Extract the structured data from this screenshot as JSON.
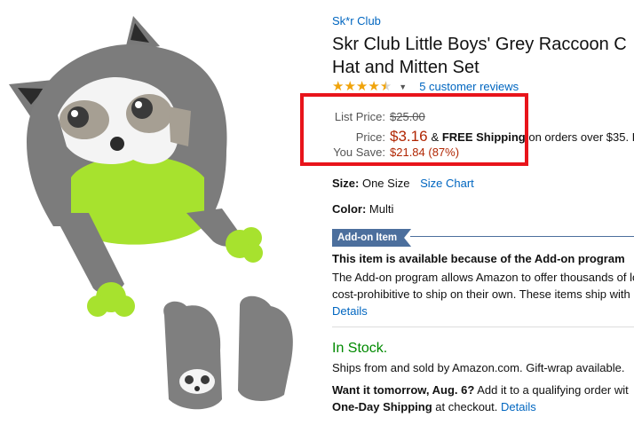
{
  "brand": "Sk*r Club",
  "title": {
    "line1": "Skr Club Little Boys' Grey Raccoon C",
    "line2": "Hat and Mitten Set"
  },
  "rating": {
    "stars": 4.5,
    "reviews_link": "5 customer reviews"
  },
  "pricing": {
    "list_label": "List Price:",
    "list_value": "$25.00",
    "price_label": "Price:",
    "price_value": "$3.16",
    "shipping_prefix": "& ",
    "shipping_bold": "FREE Shipping",
    "shipping_suffix": " on orders over $35. F",
    "save_label": "You Save:",
    "save_value": "$21.84 (87%)"
  },
  "size": {
    "label": "Size:",
    "value": "One Size",
    "chart_link": "Size Chart"
  },
  "color": {
    "label": "Color:",
    "value": "Multi"
  },
  "addon": {
    "badge": "Add-on Item",
    "title": "This item is available because of the Add-on program",
    "desc_line1": "The Add-on program allows Amazon to offer thousands of lo",
    "desc_line2": "cost-prohibitive to ship on their own. These items ship with",
    "details_link": "Details"
  },
  "availability": {
    "stock": "In Stock.",
    "ships_from": "Ships from and sold by Amazon.com. Gift-wrap available.",
    "want_bold": "Want it tomorrow, Aug. 6?",
    "want_rest": " Add it to a qualifying order wit",
    "oneday_bold": "One-Day Shipping",
    "oneday_rest": " at checkout. ",
    "details_link": "Details"
  },
  "colors": {
    "link": "#0066c0",
    "price_red": "#b12704",
    "stock_green": "#008a00",
    "highlight": "#e8141b",
    "addon_blue": "#4c6f9d"
  }
}
